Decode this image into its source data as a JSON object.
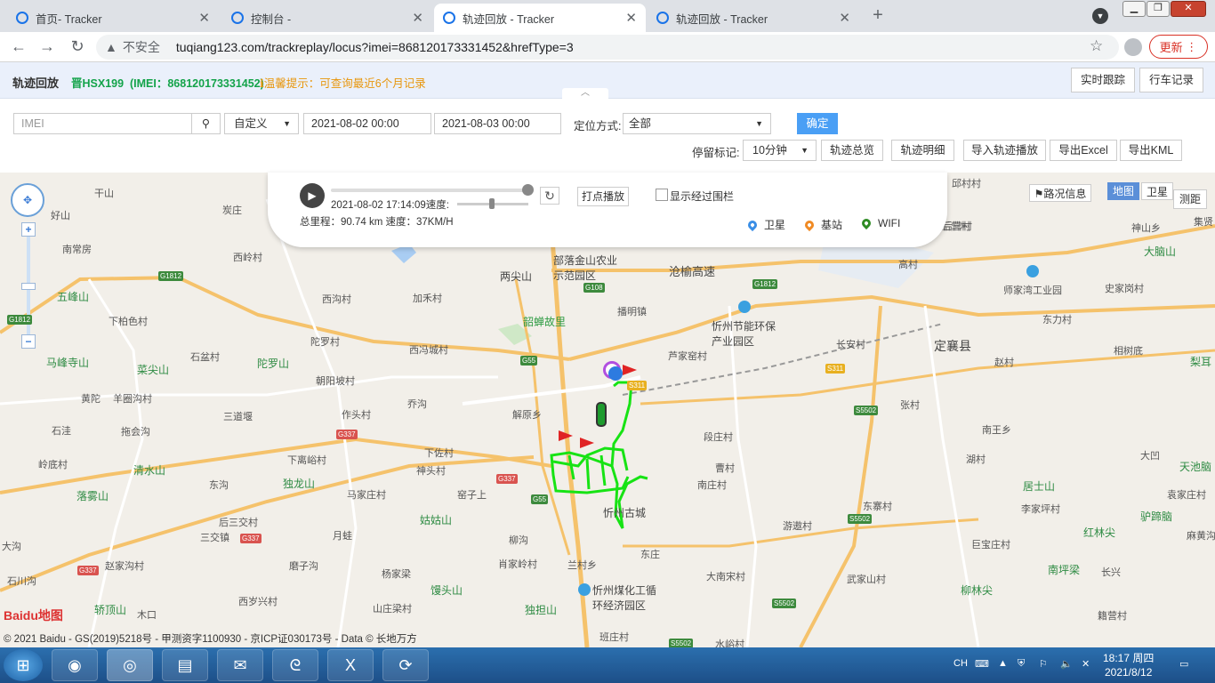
{
  "browser": {
    "tabs": [
      {
        "title": "首页- Tracker",
        "active": false
      },
      {
        "title": "控制台 -",
        "active": false
      },
      {
        "title": "轨迹回放 - Tracker",
        "active": true
      },
      {
        "title": "轨迹回放 - Tracker",
        "active": false
      }
    ],
    "security_label": "不安全",
    "url": "tuqiang123.com/trackreplay/locus?imei=868120173331452&hrefType=3",
    "update_label": "更新"
  },
  "header": {
    "title": "轨迹回放",
    "plate": "晋HSX199",
    "imei": "(IMEI：868120173331452)",
    "tip": "ℹ温馨提示：可查询最近6个月记录",
    "realtime_btn": "实时跟踪",
    "driving_btn": "行车记录"
  },
  "toolbar": {
    "imei_placeholder": "IMEI",
    "range_select": "自定义",
    "start_time": "2021-08-02 00:00",
    "end_time": "2021-08-03 00:00",
    "locate_label": "定位方式:",
    "locate_value": "全部",
    "confirm": "确定",
    "stop_label": "停留标记:",
    "stop_value": "10分钟",
    "btn_overview": "轨迹总览",
    "btn_detail": "轨迹明细",
    "btn_import": "导入轨迹播放",
    "btn_excel": "导出Excel",
    "btn_kml": "导出KML"
  },
  "player": {
    "time": "2021-08-02 17:14:09速度:",
    "dot_play": "打点播放",
    "show_fence": "显示经过围栏",
    "summary": "总里程：90.74 km 速度：37KM/H",
    "legend": [
      {
        "label": "卫星",
        "color": "#3a8ee6"
      },
      {
        "label": "基站",
        "color": "#f08a24"
      },
      {
        "label": "WIFI",
        "color": "#2e8b23"
      }
    ]
  },
  "map": {
    "traffic": "路况信息",
    "map_btn": "地图",
    "sat_btn": "卫星",
    "measure": "测距",
    "copyright": "© 2021 Baidu - GS(2019)5218号 - 甲测资字1100930 - 京ICP证030173号 - Data © 长地万方",
    "logo": "Baidu地图",
    "places": [
      {
        "t": "干山"
      },
      {
        "t": "炭庄"
      },
      {
        "t": "好山"
      },
      {
        "t": "南常房"
      },
      {
        "t": "西岭村"
      },
      {
        "t": "五峰山"
      },
      {
        "t": "下柏色村"
      },
      {
        "t": "西沟村"
      },
      {
        "t": "加禾村"
      },
      {
        "t": "两尖山"
      },
      {
        "t": "部落金山农业示范园区"
      },
      {
        "t": "沧榆高速"
      },
      {
        "t": "播明镇"
      },
      {
        "t": "忻州节能环保产业园区"
      },
      {
        "t": "韶蝉故里"
      },
      {
        "t": "马峰寺山"
      },
      {
        "t": "石盆村"
      },
      {
        "t": "陀罗村"
      },
      {
        "t": "陀罗山"
      },
      {
        "t": "西冯城村"
      },
      {
        "t": "菜尖山"
      },
      {
        "t": "朝阳坡村"
      },
      {
        "t": "芦家窑村"
      },
      {
        "t": "长安村"
      },
      {
        "t": "定襄县"
      },
      {
        "t": "黄陀"
      },
      {
        "t": "羊圈沟村"
      },
      {
        "t": "三道堰"
      },
      {
        "t": "作头村"
      },
      {
        "t": "乔沟"
      },
      {
        "t": "解原乡"
      },
      {
        "t": "段庄村"
      },
      {
        "t": "张村"
      },
      {
        "t": "石洼"
      },
      {
        "t": "拖会沟"
      },
      {
        "t": "下佐村"
      },
      {
        "t": "神头村"
      },
      {
        "t": "南王乡"
      },
      {
        "t": "岭底村"
      },
      {
        "t": "清水山"
      },
      {
        "t": "下离峪村"
      },
      {
        "t": "曹村"
      },
      {
        "t": "湖村"
      },
      {
        "t": "东沟"
      },
      {
        "t": "独龙山"
      },
      {
        "t": "马家庄村"
      },
      {
        "t": "窑子上"
      },
      {
        "t": "南庄村"
      },
      {
        "t": "居士山"
      },
      {
        "t": "落雾山"
      },
      {
        "t": "后三交村"
      },
      {
        "t": "姑姑山"
      },
      {
        "t": "东寨村"
      },
      {
        "t": "李家坪村"
      },
      {
        "t": "三交镇"
      },
      {
        "t": "月蛙"
      },
      {
        "t": "柳沟"
      },
      {
        "t": "游遨村"
      },
      {
        "t": "红林尖"
      },
      {
        "t": "赵家沟村"
      },
      {
        "t": "磨子沟"
      },
      {
        "t": "肖家岭村"
      },
      {
        "t": "东庄"
      },
      {
        "t": "巨宝庄村"
      },
      {
        "t": "石川沟"
      },
      {
        "t": "杨家梁"
      },
      {
        "t": "兰村乡"
      },
      {
        "t": "大南宋村"
      },
      {
        "t": "南坪梁"
      },
      {
        "t": "忻州煤化工循环经济园区"
      },
      {
        "t": "武家山村"
      },
      {
        "t": "柳林尖"
      },
      {
        "t": "轿顶山"
      },
      {
        "t": "西岁兴村"
      },
      {
        "t": "山庄梁村"
      },
      {
        "t": "馒头山"
      },
      {
        "t": "独担山"
      },
      {
        "t": "木口"
      },
      {
        "t": "籍营村"
      },
      {
        "t": "班庄村"
      },
      {
        "t": "水峪村"
      },
      {
        "t": "高村"
      },
      {
        "t": "师家湾工业园"
      },
      {
        "t": "史家岗村"
      },
      {
        "t": "东力村"
      },
      {
        "t": "赵村"
      },
      {
        "t": "相树底"
      },
      {
        "t": "梨耳"
      },
      {
        "t": "大脑山"
      },
      {
        "t": "神山乡"
      },
      {
        "t": "后营村"
      },
      {
        "t": "大凹"
      },
      {
        "t": "天池脑"
      },
      {
        "t": "袁家庄村"
      },
      {
        "t": "驴蹄脑"
      },
      {
        "t": "麻黄沟"
      },
      {
        "t": "长兴"
      },
      {
        "t": "邱村村"
      },
      {
        "t": "忻州古城"
      },
      {
        "t": "大沟"
      },
      {
        "t": "后营村"
      },
      {
        "t": "集贤"
      }
    ],
    "roads": [
      {
        "t": "G1812"
      },
      {
        "t": "G108"
      },
      {
        "t": "G1812"
      },
      {
        "t": "G55"
      },
      {
        "t": "S311"
      },
      {
        "t": "G337"
      },
      {
        "t": "S311"
      },
      {
        "t": "S5502"
      },
      {
        "t": "G337"
      },
      {
        "t": "G55"
      },
      {
        "t": "G337"
      },
      {
        "t": "S5502"
      },
      {
        "t": "G337"
      },
      {
        "t": "S5502"
      },
      {
        "t": "S5502"
      },
      {
        "t": "G1812"
      }
    ]
  },
  "taskbar": {
    "lang": "CH",
    "time": "18:17 周四",
    "date": "2021/8/12"
  }
}
